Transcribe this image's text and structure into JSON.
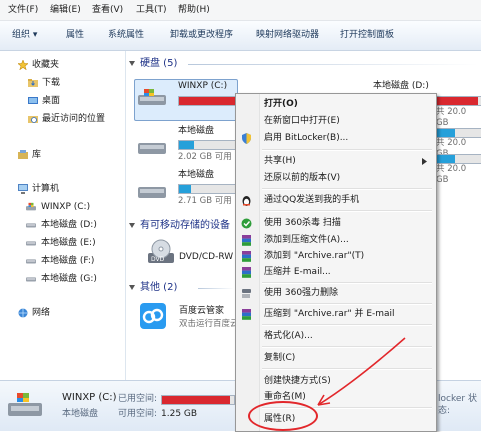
{
  "menubar": {
    "file": "文件(F)",
    "edit": "编辑(E)",
    "view": "查看(V)",
    "tools": "工具(T)",
    "help": "帮助(H)"
  },
  "toolbar": {
    "organize": "组织 ▾",
    "properties": "属性",
    "system_properties": "系统属性",
    "uninstall": "卸载或更改程序",
    "map_drive": "映射网络驱动器",
    "control_panel": "打开控制面板"
  },
  "nav": {
    "favorites": "收藏夹",
    "downloads": "下载",
    "desktop": "桌面",
    "recent": "最近访问的位置",
    "libraries": "库",
    "computer": "计算机",
    "drive_c": "WINXP (C:)",
    "drive_d": "本地磁盘 (D:)",
    "drive_e": "本地磁盘 (E:)",
    "drive_f": "本地磁盘 (F:)",
    "drive_g": "本地磁盘 (G:)",
    "network": "网络"
  },
  "content": {
    "hdd_group": "硬盘 (5)",
    "removable_group": "有可移动存储的设备",
    "other_group": "其他 (2)",
    "drive_c": {
      "name": "WINXP (C:)",
      "fill": 0.95
    },
    "drive_d": {
      "name": "本地磁盘 (D:)",
      "info": "共 20.0 GB",
      "fill": 0.9
    },
    "drive_e": {
      "name": "本地磁盘",
      "info": "2.02 GB 可用",
      "fill": 0.25
    },
    "drive_f": {
      "name": "本地磁盘",
      "info": "2.71 GB 可用",
      "fill": 0.2
    },
    "drive_d_right_info2": "共 20.0 GB",
    "drive_d_right_info3": "共 20.0 GB",
    "dvd": "DVD/CD-RW",
    "baidu_name": "百度云管家",
    "baidu_desc": "双击运行百度云"
  },
  "details": {
    "name": "WINXP (C:)",
    "used_label": "已用空间:",
    "type": "本地磁盘",
    "free_label": "可用空间:",
    "free_value": "1.25 GB",
    "right_text": "locker 状态:",
    "used_fill": 0.95
  },
  "context_menu": {
    "open": "打开(O)",
    "open_new_window": "在新窗口中打开(E)",
    "bitlocker": "启用 BitLocker(B)...",
    "share": "共享(H)",
    "restore": "还原以前的版本(V)",
    "qq_send": "通过QQ发送到我的手机",
    "scan_360": "使用 360杀毒 扫描",
    "add_archive": "添加到压缩文件(A)...",
    "add_archive_rar": "添加到 \"Archive.rar\"(T)",
    "compress_email": "压缩并 E-mail...",
    "force_delete": "使用 360强力删除",
    "compress_rar_email": "压缩到 \"Archive.rar\" 并 E-mail",
    "format": "格式化(A)...",
    "copy": "复制(C)",
    "shortcut": "创建快捷方式(S)",
    "rename": "重命名(M)",
    "properties": "属性(R)"
  },
  "colors": {
    "drive_full": "#d9282f",
    "drive_normal": "#26a0da",
    "annotation": "#e2272b"
  }
}
